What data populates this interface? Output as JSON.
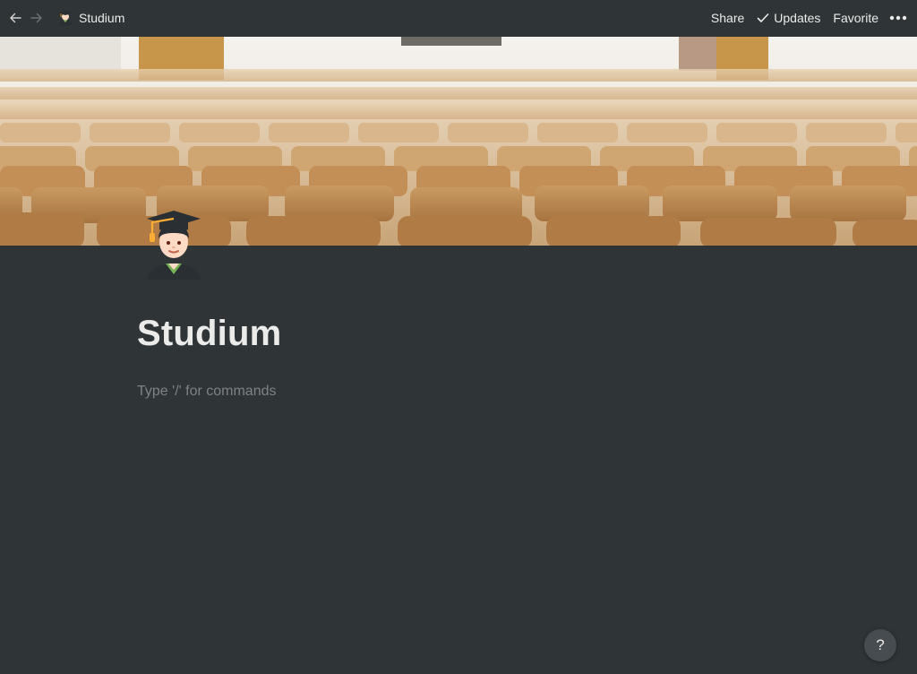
{
  "topbar": {
    "back_icon": "arrow-left-icon",
    "forward_icon": "arrow-right-icon",
    "breadcrumb": {
      "icon": "graduate-emoji-icon",
      "label": "Studium"
    },
    "share_label": "Share",
    "updates_label": "Updates",
    "updates_icon": "checkmark-icon",
    "favorite_label": "Favorite",
    "more_icon": "more-dots-icon"
  },
  "cover": {
    "description_icon": "lecture-hall-cover-image"
  },
  "page": {
    "icon": "graduate-emoji-icon",
    "title": "Studium",
    "editor_placeholder": "Type '/' for commands"
  },
  "help": {
    "label": "?"
  },
  "colors": {
    "background": "#2f3437",
    "text": "#ebebea",
    "placeholder": "#7f8285",
    "help_bg": "#474c50"
  }
}
